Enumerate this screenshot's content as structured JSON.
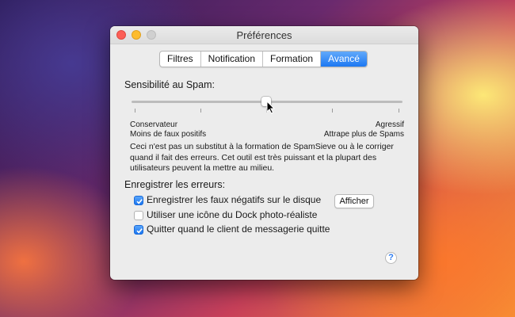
{
  "window": {
    "title": "Préférences",
    "traffic_lights": [
      "close",
      "minimize",
      "zoom"
    ]
  },
  "tabs": [
    {
      "label": "Filtres",
      "active": false
    },
    {
      "label": "Notification",
      "active": false
    },
    {
      "label": "Formation",
      "active": false
    },
    {
      "label": "Avancé",
      "active": true
    }
  ],
  "spam_sensitivity": {
    "heading": "Sensibilité au Spam:",
    "slider_value_fraction": 0.5,
    "tick_count": 5,
    "left_label_1": "Conservateur",
    "left_label_2": "Moins de faux positifs",
    "right_label_1": "Agressif",
    "right_label_2": "Attrape plus de Spams",
    "note": "Ceci n'est pas un substitut à la formation de SpamSieve ou à le corriger quand il fait des erreurs. Cet outil est très puissant et la plupart des utilisateurs peuvent la mettre au milieu."
  },
  "errors": {
    "heading": "Enregistrer les erreurs:",
    "options": [
      {
        "label": "Enregistrer les faux négatifs sur le disque",
        "checked": true
      },
      {
        "label": "Utiliser une icône du Dock photo-réaliste",
        "checked": false
      },
      {
        "label": "Quitter quand le client de messagerie quitte",
        "checked": true
      }
    ],
    "show_button": "Afficher"
  },
  "help": {
    "glyph": "?"
  },
  "colors": {
    "accent": "#1c78f2",
    "close": "#fc5f57",
    "minimize": "#fdbc2e"
  }
}
